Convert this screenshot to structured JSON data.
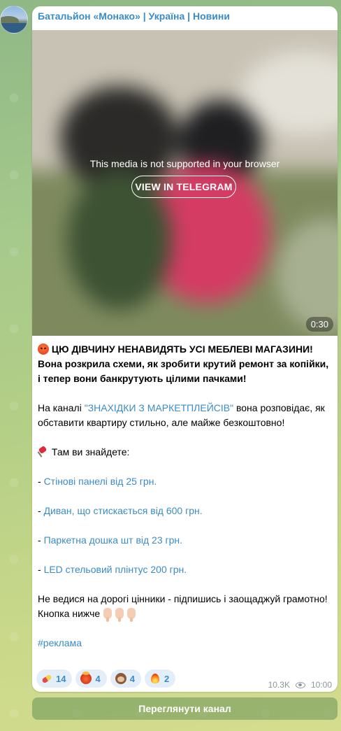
{
  "channel": {
    "name": "Батальйон «Монако» | Україна | Новини"
  },
  "media": {
    "unsupported_message": "This media is not supported in your browser",
    "view_button": "VIEW IN TELEGRAM",
    "duration": "0:30"
  },
  "post": {
    "headline": "ЦЮ ДІВЧИНУ НЕНАВИДЯТЬ УСІ МЕБЛЕВІ МАГАЗИНИ! Вона розкрила схеми, як зробити крутий ремонт за копійки, і тепер вони банкрутують цілими пачками!",
    "intro_prefix": "На каналі ",
    "intro_link": "\"ЗНАХІДКИ З МАРКЕТПЛЕЙСІВ\"",
    "intro_suffix": " вона розповідає, як обставити квартиру стильно, але майже безкоштовно!",
    "find_heading": "Там ви знайдете:",
    "items": [
      "Стінові панелі від 25 грн.",
      "Диван, що стискається від 600 грн.",
      "Паркетна дошка шт від 23 грн.",
      "LED стельовий плінтус 200 грн."
    ],
    "item_prefix": "- ",
    "outro_line1": "Не ведися на дорогі цінники - підпишись і заощаджуй грамотно!",
    "outro_line2": "Кнопка нижче",
    "hashtag": "#реклама"
  },
  "reactions": [
    {
      "icon": "pill-icon",
      "count": "14"
    },
    {
      "icon": "exploding-head-icon",
      "count": "4"
    },
    {
      "icon": "see-no-evil-monkey-icon",
      "count": "4"
    },
    {
      "icon": "fire-icon",
      "count": "2"
    }
  ],
  "meta": {
    "views": "10.3K",
    "time": "10:00"
  },
  "footer": {
    "view_channel": "Переглянути канал"
  },
  "colors": {
    "link": "#3a8cc7",
    "bubble": "#ffffff",
    "reaction_bg": "#e3eef8"
  }
}
